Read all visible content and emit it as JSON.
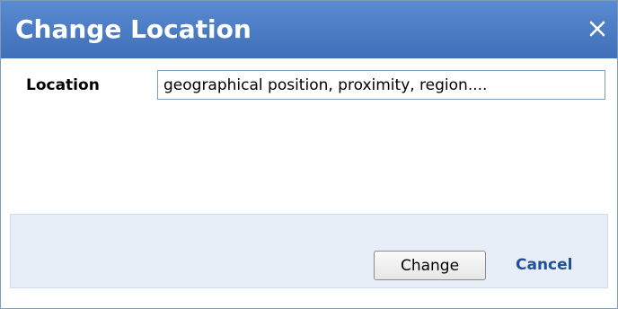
{
  "dialog": {
    "title": "Change Location",
    "close_icon": "close-icon"
  },
  "form": {
    "location_label": "Location",
    "location_value": "geographical position, proximity, region...."
  },
  "footer": {
    "change_label": "Change",
    "cancel_label": "Cancel"
  },
  "colors": {
    "titlebar": "#3f6fb8",
    "footer_background": "#e8eef8",
    "link": "#1f4fa0"
  }
}
